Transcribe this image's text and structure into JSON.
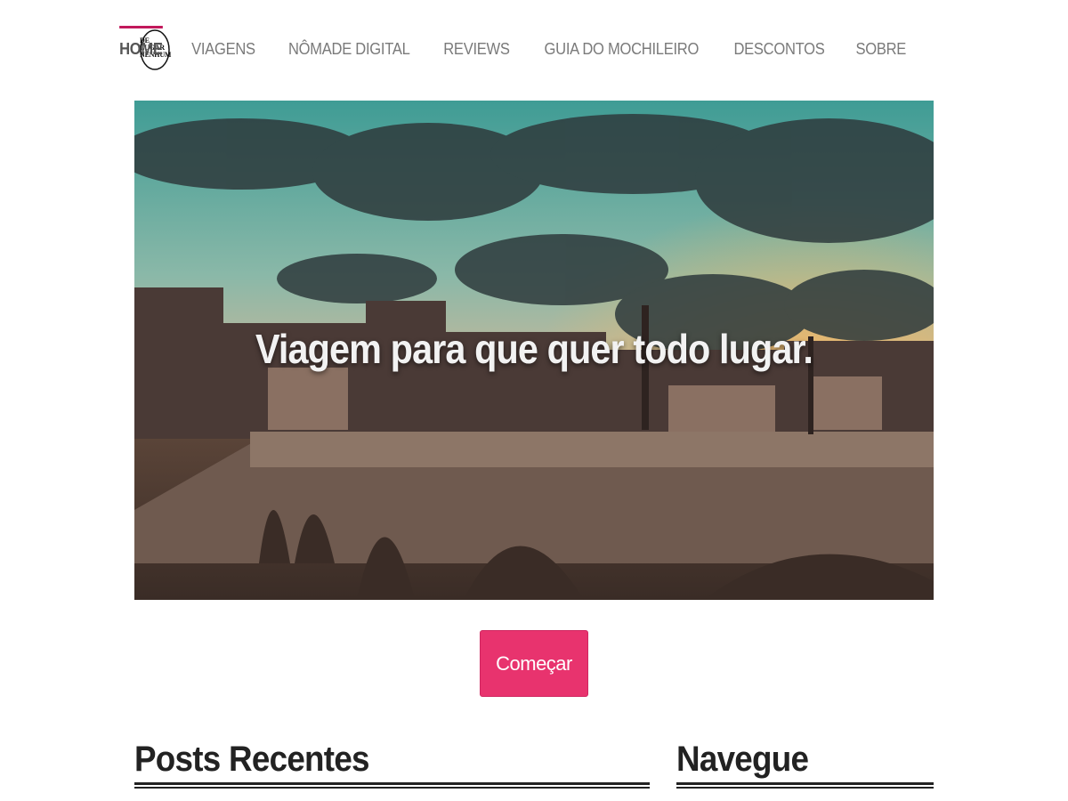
{
  "logo": {
    "lines": [
      "DE",
      "LUGAR",
      "NENHUM"
    ]
  },
  "nav": {
    "items": [
      {
        "label": "HOME",
        "active": true
      },
      {
        "label": "VIAGENS",
        "active": false
      },
      {
        "label": "NÔMADE DIGITAL",
        "active": false
      },
      {
        "label": "REVIEWS",
        "active": false
      },
      {
        "label": "GUIA DO MOCHILEIRO",
        "active": false
      },
      {
        "label": "DESCONTOS",
        "active": false
      },
      {
        "label": "SOBRE",
        "active": false
      }
    ]
  },
  "hero": {
    "title": "Viagem para que quer todo lugar."
  },
  "cta": {
    "label": "Começar"
  },
  "sections": {
    "recent_posts": "Posts Recentes",
    "browse": "Navegue"
  },
  "colors": {
    "accent": "#e8336e",
    "nav_active_bar": "#c2185b"
  }
}
